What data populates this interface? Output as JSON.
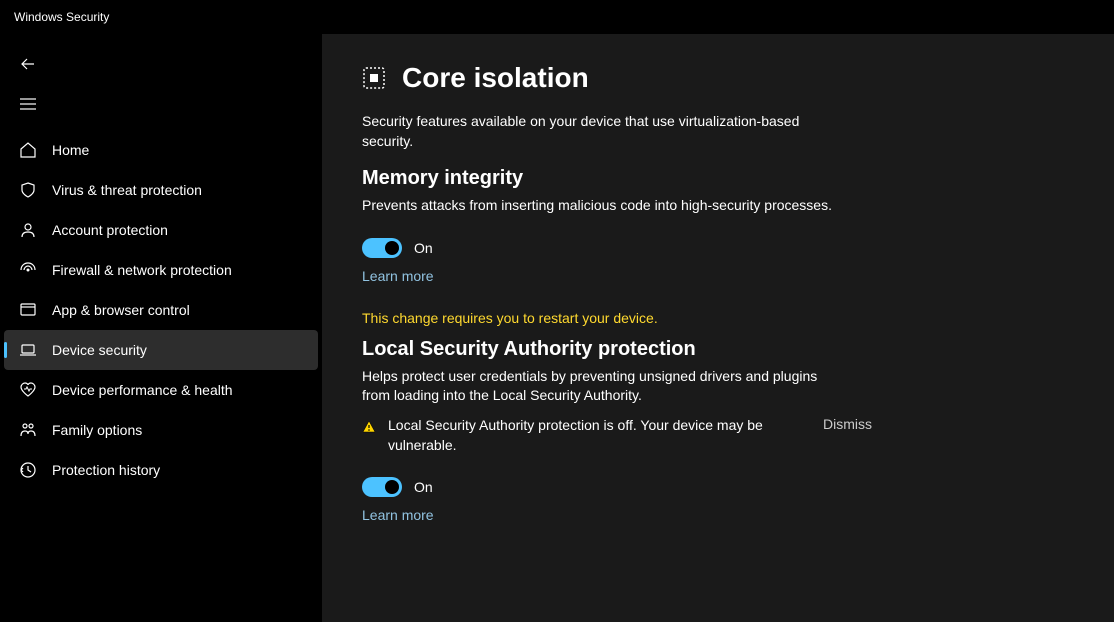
{
  "app_title": "Windows Security",
  "sidebar": {
    "items": [
      {
        "label": "Home",
        "icon": "home"
      },
      {
        "label": "Virus & threat protection",
        "icon": "shield"
      },
      {
        "label": "Account protection",
        "icon": "person"
      },
      {
        "label": "Firewall & network protection",
        "icon": "signal"
      },
      {
        "label": "App & browser control",
        "icon": "app"
      },
      {
        "label": "Device security",
        "icon": "laptop",
        "selected": true
      },
      {
        "label": "Device performance & health",
        "icon": "heart"
      },
      {
        "label": "Family options",
        "icon": "family"
      },
      {
        "label": "Protection history",
        "icon": "history"
      }
    ]
  },
  "page": {
    "title": "Core isolation",
    "description": "Security features available on your device that use virtualization-based security."
  },
  "memory_integrity": {
    "title": "Memory integrity",
    "description": "Prevents attacks from inserting malicious code into high-security processes.",
    "toggle_state": "On",
    "learn_more": "Learn more",
    "restart_note": "This change requires you to restart your device."
  },
  "lsa": {
    "title": "Local Security Authority protection",
    "description": "Helps protect user credentials by preventing unsigned drivers and plugins from loading into the Local Security Authority.",
    "warning": "Local Security Authority protection is off. Your device may be vulnerable.",
    "dismiss": "Dismiss",
    "toggle_state": "On",
    "learn_more": "Learn more"
  }
}
